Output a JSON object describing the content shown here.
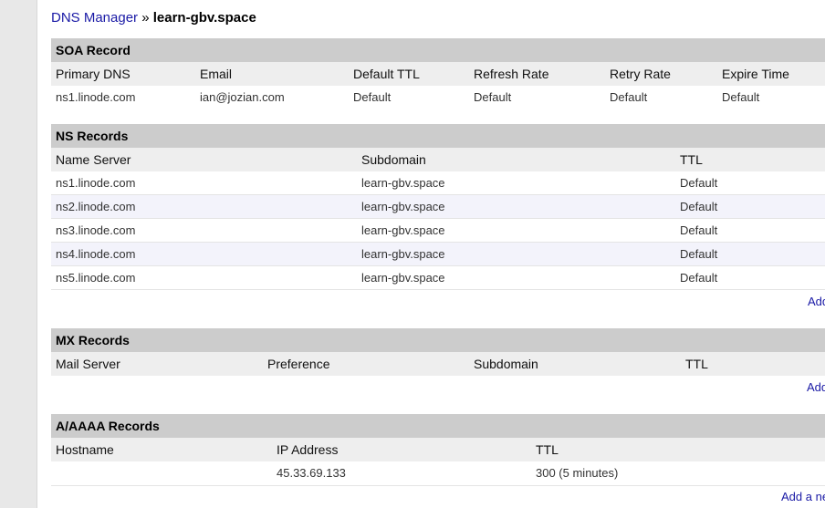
{
  "breadcrumb": {
    "parent": "DNS Manager",
    "separator": "»",
    "current": "learn-gbv.space"
  },
  "soa": {
    "title": "SOA Record",
    "headers": [
      "Primary DNS",
      "Email",
      "Default TTL",
      "Refresh Rate",
      "Retry Rate",
      "Expire Time"
    ],
    "row": [
      "ns1.linode.com",
      "ian@jozian.com",
      "Default",
      "Default",
      "Default",
      "Default"
    ]
  },
  "ns": {
    "title": "NS Records",
    "headers": [
      "Name Server",
      "Subdomain",
      "TTL"
    ],
    "rows": [
      [
        "ns1.linode.com",
        "learn-gbv.space",
        "Default"
      ],
      [
        "ns2.linode.com",
        "learn-gbv.space",
        "Default"
      ],
      [
        "ns3.linode.com",
        "learn-gbv.space",
        "Default"
      ],
      [
        "ns4.linode.com",
        "learn-gbv.space",
        "Default"
      ],
      [
        "ns5.linode.com",
        "learn-gbv.space",
        "Default"
      ]
    ],
    "add_link": "Add"
  },
  "mx": {
    "title": "MX Records",
    "headers": [
      "Mail Server",
      "Preference",
      "Subdomain",
      "TTL"
    ],
    "add_link": "Add"
  },
  "a": {
    "title": "A/AAAA Records",
    "headers": [
      "Hostname",
      "IP Address",
      "TTL"
    ],
    "rows": [
      [
        "",
        "45.33.69.133",
        "300 (5 minutes)"
      ]
    ],
    "add_link": "Add a ne"
  },
  "colors": {
    "link": "#1a1aa6",
    "section_header_bg": "#cccccc",
    "column_header_bg": "#eeeeee",
    "alt_row_bg": "#f3f3fb"
  }
}
